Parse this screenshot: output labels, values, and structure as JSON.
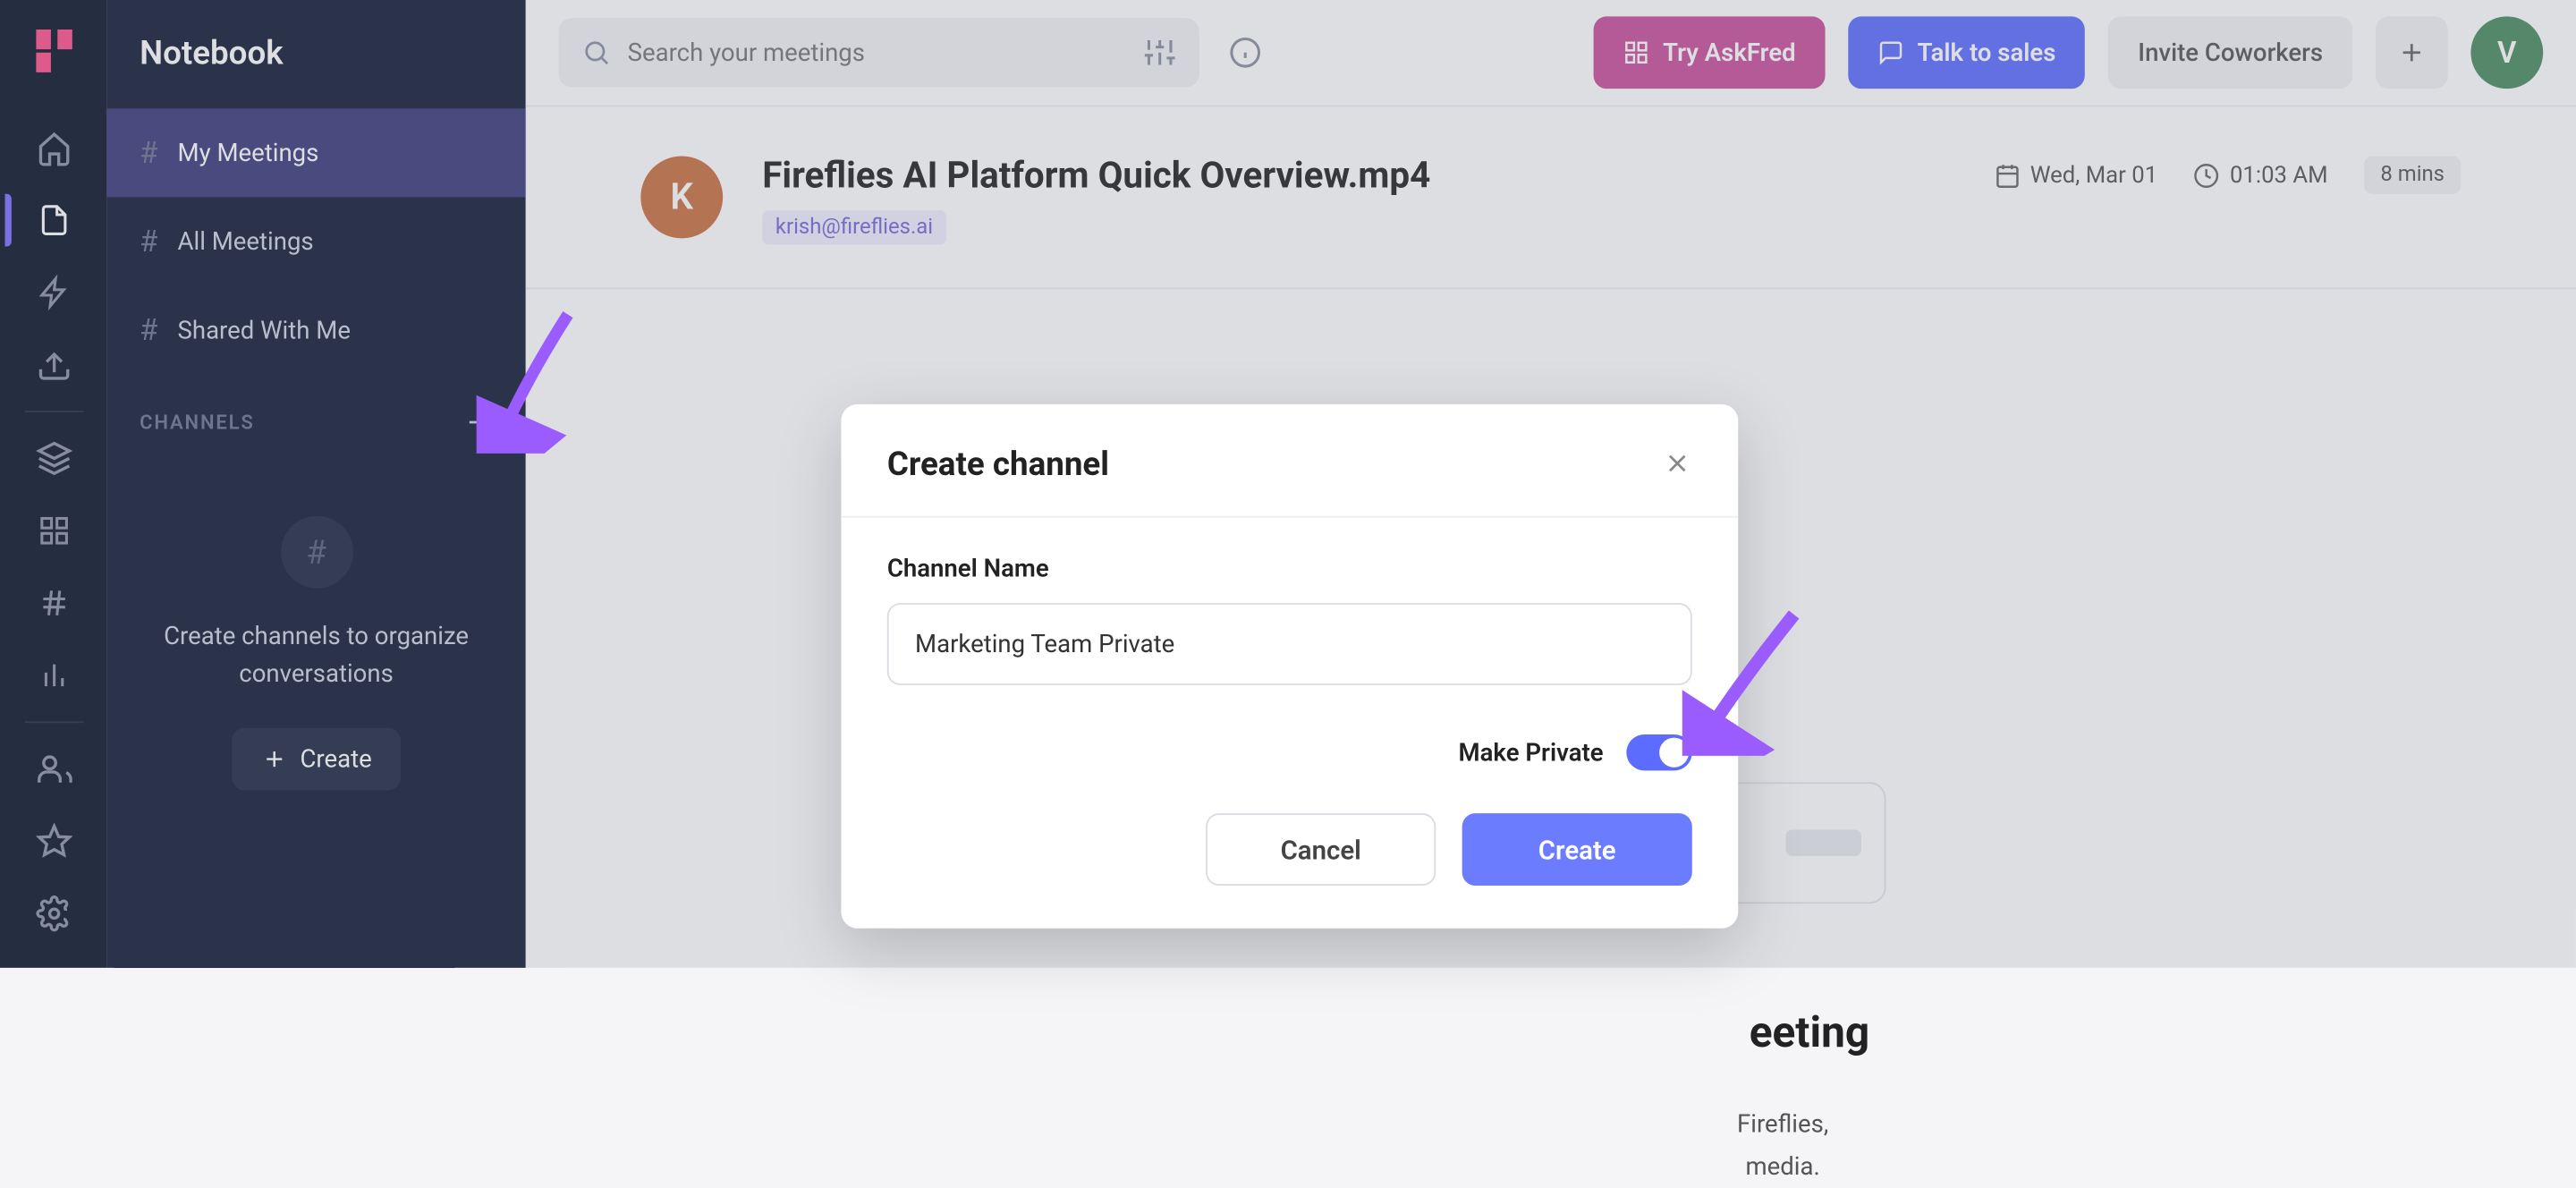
{
  "sidebar": {
    "title": "Notebook",
    "items": [
      {
        "label": "My Meetings"
      },
      {
        "label": "All Meetings"
      },
      {
        "label": "Shared With Me"
      }
    ],
    "channels_header": "CHANNELS",
    "channels_empty_msg": "Create channels to organize conversations",
    "channels_create": "Create"
  },
  "topbar": {
    "search_placeholder": "Search your meetings",
    "try_askfred": "Try AskFred",
    "talk_to_sales": "Talk to sales",
    "invite": "Invite Coworkers",
    "avatar_initial": "V"
  },
  "meeting": {
    "avatar_initial": "K",
    "title": "Fireflies AI Platform Quick Overview.mp4",
    "email": "krish@fireflies.ai",
    "date": "Wed, Mar 01",
    "time": "01:03 AM",
    "duration": "8 mins"
  },
  "modal": {
    "title": "Create channel",
    "label": "Channel Name",
    "value": "Marketing Team Private",
    "make_private": "Make Private",
    "cancel": "Cancel",
    "create": "Create"
  },
  "ghost": {
    "heading": "eeting",
    "line1": "Fireflies,",
    "line2": "media."
  }
}
